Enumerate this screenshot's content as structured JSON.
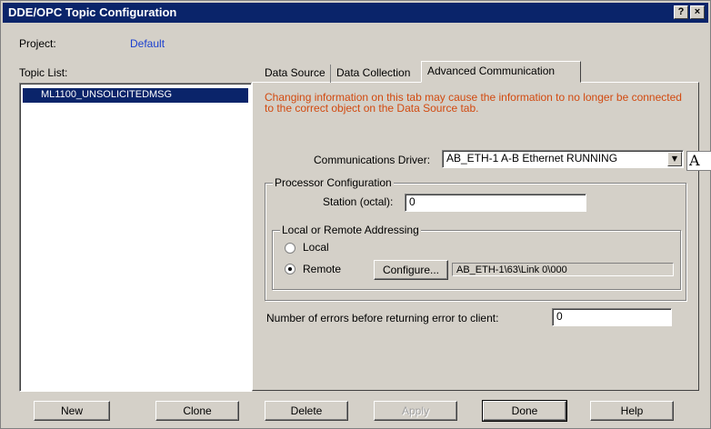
{
  "window": {
    "title": "DDE/OPC Topic Configuration",
    "help_btn": "?",
    "close_btn": "×"
  },
  "project": {
    "label": "Project:",
    "value": "Default"
  },
  "topic_list": {
    "label": "Topic List:",
    "items": [
      "ML1100_UNSOLICITEDMSG"
    ]
  },
  "tabs": [
    {
      "label": "Data Source"
    },
    {
      "label": "Data Collection"
    },
    {
      "label": "Advanced Communication"
    }
  ],
  "advanced": {
    "warning": "Changing information on this tab may cause the information to no longer be connected to the correct object on the Data Source tab.",
    "driver_label": "Communications Driver:",
    "driver_value": "AB_ETH-1  A-B Ethernet  RUNNING",
    "ime_glyph": "A",
    "processor_group": "Processor Configuration",
    "station_label": "Station (octal):",
    "station_value": "0",
    "addressing_group": "Local or Remote Addressing",
    "local_label": "Local",
    "remote_label": "Remote",
    "configure_label": "Configure...",
    "route_value": "AB_ETH-1\\63\\Link 0\\000",
    "errors_label": "Number of errors before returning error to client:",
    "errors_value": "0"
  },
  "buttons": {
    "new": "New",
    "clone": "Clone",
    "delete": "Delete",
    "apply": "Apply",
    "done": "Done",
    "help": "Help"
  },
  "colors": {
    "titlebar": "#0a246a",
    "warning": "#d24a10",
    "project_value": "#1a3fd0"
  }
}
